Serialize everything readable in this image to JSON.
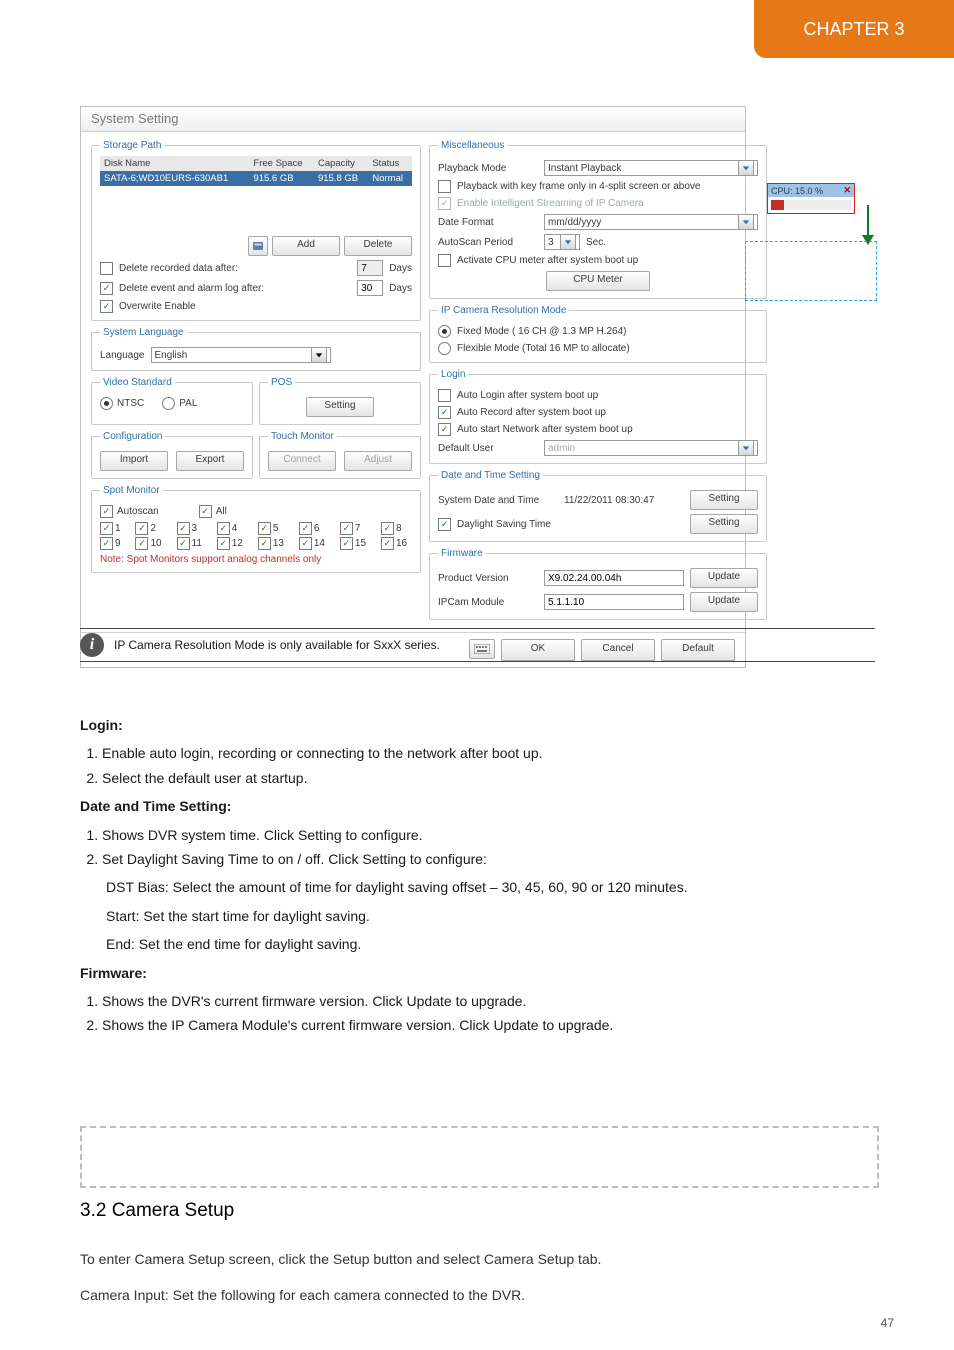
{
  "chapter_tab": "CHAPTER 3",
  "dialog": {
    "title": "System Setting",
    "storage": {
      "legend": "Storage Path",
      "cols": {
        "a": "Disk Name",
        "b": "Free Space",
        "c": "Capacity",
        "d": "Status"
      },
      "row": {
        "a": "SATA-6;WD10EURS-630AB1",
        "b": "915.6 GB",
        "c": "915.8 GB",
        "d": "Normal"
      },
      "add": "Add",
      "delete": "Delete",
      "del_rec": "Delete recorded data after:",
      "del_rec_val": "7",
      "del_evt": "Delete event and alarm log after:",
      "del_evt_val": "30",
      "days": "Days",
      "overwrite": "Overwrite Enable"
    },
    "lang": {
      "legend": "System Language",
      "label": "Language",
      "value": "English"
    },
    "video": {
      "legend": "Video Standard",
      "ntsc": "NTSC",
      "pal": "PAL"
    },
    "pos": {
      "legend": "POS",
      "btn": "Setting"
    },
    "config": {
      "legend": "Configuration",
      "imp": "Import",
      "exp": "Export"
    },
    "touch": {
      "legend": "Touch Monitor",
      "con": "Connect",
      "adj": "Adjust"
    },
    "spot": {
      "legend": "Spot Monitor",
      "autoscan": "Autoscan",
      "all": "All",
      "ch": [
        "1",
        "2",
        "3",
        "4",
        "5",
        "6",
        "7",
        "8",
        "9",
        "10",
        "11",
        "12",
        "13",
        "14",
        "15",
        "16"
      ],
      "note": "Note: Spot Monitors support analog channels only"
    },
    "misc": {
      "legend": "Miscellaneous",
      "pbmode": "Playback Mode",
      "pbval": "Instant Playback",
      "keyframe": "Playback with key frame only in 4-split screen or above",
      "intel": "Enable Intelligent Streaming of IP Camera",
      "datefmt_l": "Date Format",
      "datefmt_v": "mm/dd/yyyy",
      "autoscan_l": "AutoScan Period",
      "autoscan_v": "3",
      "sec": "Sec.",
      "cpu_cb": "Activate CPU meter after system boot up",
      "cpu_btn": "CPU Meter"
    },
    "ipres": {
      "legend": "IP Camera Resolution Mode",
      "fixed": "Fixed Mode ( 16 CH @ 1.3 MP H.264)",
      "flex": "Flexible Mode (Total 16 MP to allocate)"
    },
    "login": {
      "legend": "Login",
      "auto_login": "Auto Login after system boot up",
      "auto_rec": "Auto Record after system boot up",
      "auto_net": "Auto start Network after system boot up",
      "def_user_l": "Default User",
      "def_user_v": "admin"
    },
    "dt": {
      "legend": "Date and Time Setting",
      "sysdt_l": "System Date and Time",
      "sysdt_v": "11/22/2011  08:30:47",
      "setting": "Setting",
      "dst": "Daylight Saving Time"
    },
    "fw": {
      "legend": "Firmware",
      "pv_l": "Product Version",
      "pv_v": "X9.02.24.00.04h",
      "ipc_l": "IPCam Module",
      "ipc_v": "5.1.1.10",
      "upd": "Update"
    },
    "footer": {
      "ok": "OK",
      "cancel": "Cancel",
      "def": "Default"
    }
  },
  "cpu_popup": {
    "title": "CPU: 15.0 %"
  },
  "info_line": "IP Camera Resolution Mode is only available for SxxX series.",
  "body": {
    "login_hdr": "Login:",
    "login_items": [
      "Enable auto login, recording or connecting to the network after boot up.",
      "Select the default user at startup."
    ],
    "date_hdr": "Date and Time Setting:",
    "date_items": [
      "Shows DVR system time. Click Setting to configure.",
      "Set Daylight Saving Time to on / off. Click Setting to configure:"
    ],
    "date_sub": [
      "DST Bias: Select the amount of time for daylight saving offset – 30, 45, 60, 90 or 120 minutes.",
      "Start: Set the start time for daylight saving.",
      "End: Set the end time for daylight saving."
    ],
    "fw_hdr": "Firmware:",
    "fw_items": [
      "Shows the DVR's current firmware version. Click Update to upgrade.",
      "Shows the IP Camera Module's current firmware version. Click Update to upgrade."
    ],
    "sect_title": "3.2 Camera Setup",
    "cam_intro": "To enter Camera Setup screen, click the Setup button and select Camera Setup tab.",
    "cam_input": "Camera Input: Set the following for each camera connected to the DVR."
  },
  "pageno": "47"
}
